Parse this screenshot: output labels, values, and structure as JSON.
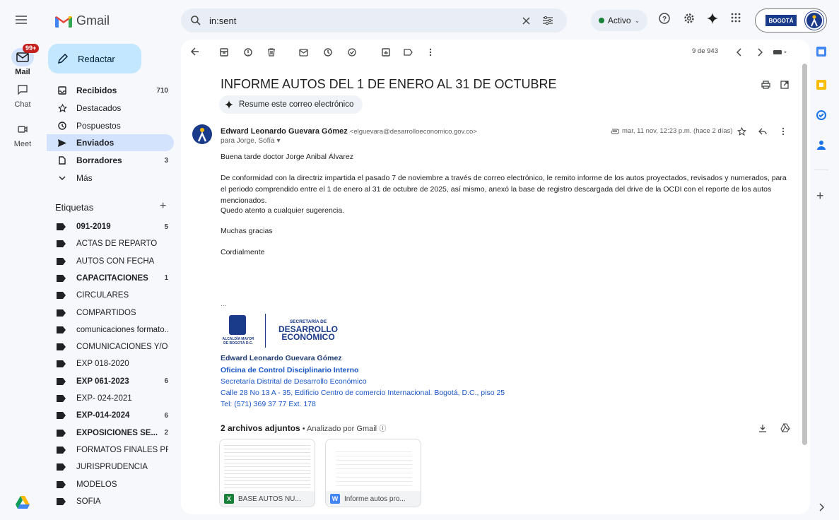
{
  "app": {
    "name": "Gmail"
  },
  "rail": {
    "mail_label": "Mail",
    "mail_badge": "99+",
    "chat_label": "Chat",
    "meet_label": "Meet"
  },
  "compose": {
    "label": "Redactar"
  },
  "nav": [
    {
      "label": "Recibidos",
      "count": "710",
      "bold": true
    },
    {
      "label": "Destacados",
      "count": ""
    },
    {
      "label": "Pospuestos",
      "count": ""
    },
    {
      "label": "Enviados",
      "count": "",
      "bold": true,
      "selected": true
    },
    {
      "label": "Borradores",
      "count": "3",
      "bold": true
    },
    {
      "label": "Más",
      "count": ""
    }
  ],
  "labels_title": "Etiquetas",
  "labels": [
    {
      "label": "091-2019",
      "count": "5",
      "bold": true
    },
    {
      "label": "ACTAS DE REPARTO",
      "count": ""
    },
    {
      "label": "AUTOS CON FECHA",
      "count": ""
    },
    {
      "label": "CAPACITACIONES",
      "count": "1",
      "bold": true
    },
    {
      "label": "CIRCULARES",
      "count": ""
    },
    {
      "label": "COMPARTIDOS",
      "count": ""
    },
    {
      "label": "comunicaciones formato...",
      "count": ""
    },
    {
      "label": "COMUNICACIONES Y/O ...",
      "count": ""
    },
    {
      "label": "EXP 018-2020",
      "count": ""
    },
    {
      "label": "EXP 061-2023",
      "count": "6",
      "bold": true
    },
    {
      "label": "EXP- 024-2021",
      "count": ""
    },
    {
      "label": "EXP-014-2024",
      "count": "6",
      "bold": true
    },
    {
      "label": "EXPOSICIONES SE...",
      "count": "2",
      "bold": true
    },
    {
      "label": "FORMATOS FINALES PR...",
      "count": ""
    },
    {
      "label": "JURISPRUDENCIA",
      "count": ""
    },
    {
      "label": "MODELOS",
      "count": ""
    },
    {
      "label": "SOFÍA",
      "count": ""
    }
  ],
  "search": {
    "value": "in:sent"
  },
  "status": {
    "label": "Activo"
  },
  "org": {
    "label": "BOGOTÁ"
  },
  "toolbar": {
    "pager": "9 de 943"
  },
  "email": {
    "subject": "INFORME AUTOS DEL 1 DE ENERO AL 31 DE OCTUBRE",
    "summarize": "Resume este correo electrónico",
    "sender_name": "Edward Leonardo Guevara Gómez",
    "sender_email": "<elguevara@desarrolloeconomico.gov.co>",
    "recipients": "para Jorge, Sofía",
    "date": "mar, 11 nov, 12:23 p.m. (hace 2 días)",
    "body": [
      "Buena tarde doctor Jorge Anibal Álvarez",
      "De conformidad con la directriz impartida el pasado 7 de noviembre a través de correo electrónico, le remito informe de los autos proyectados, revisados y numerados, para el periodo comprendido entre el 1 de enero al 31 de octubre de 2025, así mismo, anexó la base de registro descargada del drive de la OCDI con el reporte de los autos mencionados.",
      "Quedo atento a cualquier sugerencia.",
      "Muchas gracias",
      "Cordialmente"
    ],
    "ellipsis": "...",
    "logo": {
      "left1": "ALCALDÍA MAYOR",
      "left2": "DE BOGOTÁ D.C.",
      "right1": "SECRETARÍA DE",
      "right2": "DESARROLLO",
      "right3": "ECONÓMICO"
    },
    "signature": {
      "name": "Edward Leonardo Guevara Gómez",
      "office": "Oficina de Control Disciplinario Interno",
      "entity": "Secretaría Distrital de Desarrollo Económico",
      "address": "Calle 28 No 13 A - 35, Edificio Centro de comercio Internacional. Bogotá, D.C., piso 25",
      "tel": "Tel: (571) 369 37 77 Ext. 178"
    },
    "attachments_header": "2 archivos adjuntos",
    "attachments_scan": " • Analizado por Gmail",
    "attachments": [
      {
        "name": "BASE AUTOS NU...",
        "type": "X",
        "color": "#188038"
      },
      {
        "name": "Informe autos pro...",
        "type": "W",
        "color": "#4285f4"
      }
    ]
  }
}
